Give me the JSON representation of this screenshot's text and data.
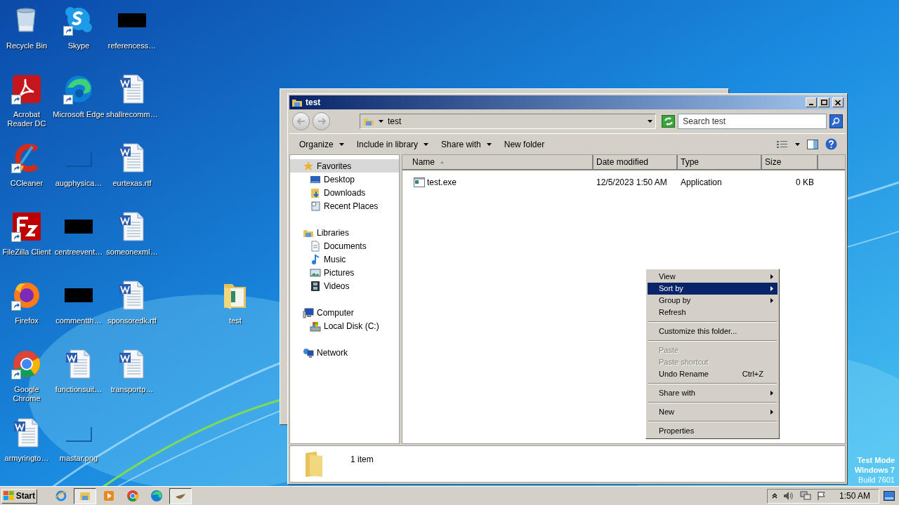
{
  "desktop": {
    "icons": [
      {
        "label": "Recycle Bin",
        "kind": "trash",
        "shortcut": false
      },
      {
        "label": "Skype",
        "kind": "chat",
        "shortcut": true
      },
      {
        "label": "referencess…",
        "kind": "redacted",
        "shortcut": false
      },
      {
        "label": "Acrobat Reader DC",
        "kind": "pdf",
        "shortcut": true
      },
      {
        "label": "Microsoft Edge",
        "kind": "browser",
        "shortcut": true
      },
      {
        "label": "shallrecomm…",
        "kind": "word",
        "shortcut": false
      },
      {
        "label": "CCleaner",
        "kind": "cleaner",
        "shortcut": true
      },
      {
        "label": "augphysica…",
        "kind": "blank",
        "shortcut": false
      },
      {
        "label": "eurtexas.rtf",
        "kind": "word",
        "shortcut": false
      },
      {
        "label": "FileZilla Client",
        "kind": "ftp",
        "shortcut": true
      },
      {
        "label": "centreevent…",
        "kind": "redacted",
        "shortcut": false
      },
      {
        "label": "someonexml…",
        "kind": "word",
        "shortcut": false
      },
      {
        "label": "Firefox",
        "kind": "fox",
        "shortcut": true
      },
      {
        "label": "commentth…",
        "kind": "redacted",
        "shortcut": false
      },
      {
        "label": "sponsoredk.rtf",
        "kind": "word",
        "shortcut": false
      },
      {
        "label": "Google Chrome",
        "kind": "chrome",
        "shortcut": true
      },
      {
        "label": "functionsuit…",
        "kind": "word",
        "shortcut": false
      },
      {
        "label": "transportp…",
        "kind": "word",
        "shortcut": false
      },
      {
        "label": "armyringto…",
        "kind": "word",
        "shortcut": false
      },
      {
        "label": "mastar.png",
        "kind": "blank",
        "shortcut": false
      }
    ],
    "folder": {
      "label": "test",
      "kind": "folder",
      "shortcut": false
    }
  },
  "explorer": {
    "title": "test",
    "address": "test",
    "search": {
      "placeholder": "Search test"
    },
    "toolbar": [
      {
        "label": "Organize",
        "dropdown": true
      },
      {
        "label": "Include in library",
        "dropdown": true
      },
      {
        "label": "Share with",
        "dropdown": true
      },
      {
        "label": "New folder",
        "dropdown": false
      }
    ],
    "nav": [
      {
        "label": "Favorites",
        "kind": "star",
        "selected": true,
        "children": [
          {
            "label": "Desktop",
            "kind": "desktop",
            "selected": false
          },
          {
            "label": "Downloads",
            "kind": "downloads",
            "selected": false
          },
          {
            "label": "Recent Places",
            "kind": "recent",
            "selected": false
          }
        ]
      },
      {
        "label": "Libraries",
        "kind": "library",
        "selected": false,
        "children": [
          {
            "label": "Documents",
            "kind": "documents",
            "selected": false
          },
          {
            "label": "Music",
            "kind": "music",
            "selected": false
          },
          {
            "label": "Pictures",
            "kind": "pictures",
            "selected": false
          },
          {
            "label": "Videos",
            "kind": "videos",
            "selected": false
          }
        ]
      },
      {
        "label": "Computer",
        "kind": "computer",
        "selected": false,
        "children": [
          {
            "label": "Local Disk (C:)",
            "kind": "disk",
            "selected": false
          }
        ]
      },
      {
        "label": "Network",
        "kind": "network",
        "selected": false
      }
    ],
    "columns": [
      {
        "label": "Name",
        "sorted": true
      },
      {
        "label": "Date modified",
        "sorted": false
      },
      {
        "label": "Type",
        "sorted": false
      },
      {
        "label": "Size",
        "sorted": false
      }
    ],
    "files": [
      {
        "name": "test.exe",
        "date": "12/5/2023 1:50 AM",
        "type": "Application",
        "size": "0 KB"
      }
    ],
    "status": "1 item"
  },
  "context_menu": [
    {
      "kind": "item",
      "label": "View",
      "submenu": true,
      "selected": false,
      "disabled": false
    },
    {
      "kind": "item",
      "label": "Sort by",
      "submenu": true,
      "selected": true,
      "disabled": false
    },
    {
      "kind": "item",
      "label": "Group by",
      "submenu": true,
      "selected": false,
      "disabled": false
    },
    {
      "kind": "item",
      "label": "Refresh",
      "submenu": false,
      "selected": false,
      "disabled": false
    },
    {
      "kind": "separator"
    },
    {
      "kind": "item",
      "label": "Customize this folder...",
      "submenu": false,
      "selected": false,
      "disabled": false
    },
    {
      "kind": "separator"
    },
    {
      "kind": "item",
      "label": "Paste",
      "submenu": false,
      "selected": false,
      "disabled": true
    },
    {
      "kind": "item",
      "label": "Paste shortcut",
      "submenu": false,
      "selected": false,
      "disabled": true
    },
    {
      "kind": "item",
      "label": "Undo Rename",
      "shortcut": "Ctrl+Z",
      "submenu": false,
      "selected": false,
      "disabled": false
    },
    {
      "kind": "separator"
    },
    {
      "kind": "item",
      "label": "Share with",
      "submenu": true,
      "selected": false,
      "disabled": false
    },
    {
      "kind": "separator"
    },
    {
      "kind": "item",
      "label": "New",
      "submenu": true,
      "selected": false,
      "disabled": false
    },
    {
      "kind": "separator"
    },
    {
      "kind": "item",
      "label": "Properties",
      "submenu": false,
      "selected": false,
      "disabled": false
    }
  ],
  "test_mode": [
    "Test Mode",
    "Windows 7",
    "Build 7601"
  ],
  "taskbar": {
    "start": "Start",
    "apps": [
      {
        "kind": "ie",
        "active": false
      },
      {
        "kind": "explorer",
        "active": true
      },
      {
        "kind": "media",
        "active": false
      },
      {
        "kind": "chrome",
        "active": false
      },
      {
        "kind": "edge",
        "active": false
      },
      {
        "kind": "melon",
        "active": true
      }
    ],
    "clock": "1:50 AM"
  }
}
